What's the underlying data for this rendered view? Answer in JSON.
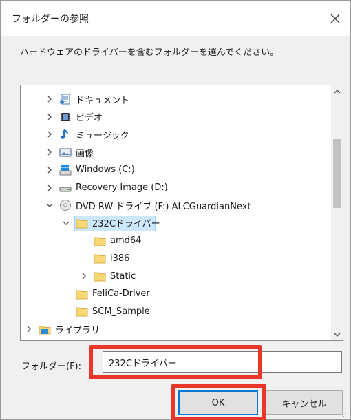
{
  "dialog": {
    "title": "フォルダーの参照",
    "instruction": "ハードウェアのドライバーを含むフォルダーを選んでください。"
  },
  "tree": {
    "items": [
      {
        "label": "ドキュメント",
        "icon": "documents-icon",
        "chevron": "right"
      },
      {
        "label": "ビデオ",
        "icon": "videos-icon",
        "chevron": "right"
      },
      {
        "label": "ミュージック",
        "icon": "music-icon",
        "chevron": "right"
      },
      {
        "label": "画像",
        "icon": "pictures-icon",
        "chevron": "right"
      },
      {
        "label": "Windows (C:)",
        "icon": "windows-drive-icon",
        "chevron": "right"
      },
      {
        "label": "Recovery Image (D:)",
        "icon": "drive-icon",
        "chevron": "right"
      },
      {
        "label": "DVD RW ドライブ (F:) ALCGuardianNext",
        "icon": "dvd-drive-icon",
        "chevron": "down"
      },
      {
        "label": "232Cドライバー",
        "icon": "folder-icon",
        "chevron": "down",
        "selected": true
      },
      {
        "label": "amd64",
        "icon": "folder-icon",
        "chevron": "none"
      },
      {
        "label": "i386",
        "icon": "folder-icon",
        "chevron": "none"
      },
      {
        "label": "Static",
        "icon": "folder-icon",
        "chevron": "right"
      },
      {
        "label": "FeliCa-Driver",
        "icon": "folder-icon",
        "chevron": "none"
      },
      {
        "label": "SCM_Sample",
        "icon": "folder-icon",
        "chevron": "none"
      },
      {
        "label": "ライブラリ",
        "icon": "library-icon",
        "chevron": "right"
      }
    ]
  },
  "folder_field": {
    "label": "フォルダー(F):",
    "value": "232Cドライバー"
  },
  "buttons": {
    "ok": "OK",
    "cancel": "キャンセル"
  },
  "colors": {
    "highlight": "#e8362b",
    "selection": "#cce8ff",
    "accent": "#0078d7",
    "folder": "#f8d775"
  }
}
